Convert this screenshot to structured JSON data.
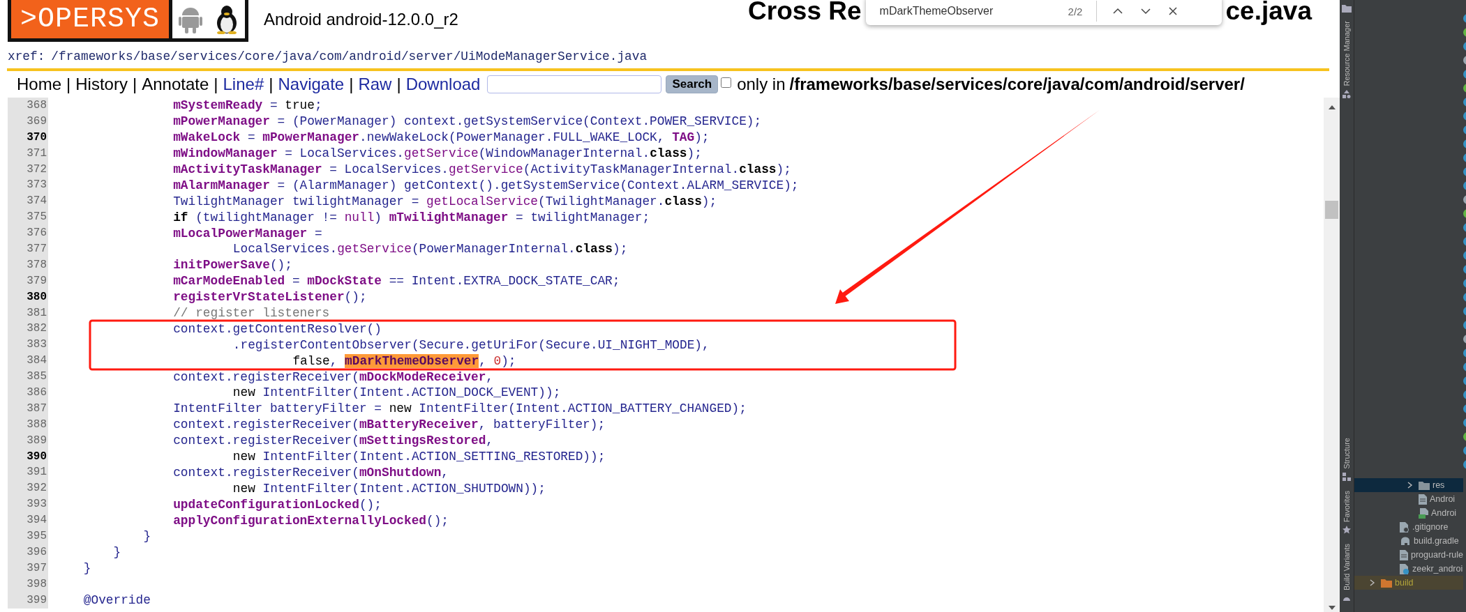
{
  "header": {
    "logo_text": ">OPERSYS",
    "project": "Android android-12.0.0_r2",
    "title_parts": [
      "Cross Re",
      "ce.java"
    ]
  },
  "find_bar": {
    "value": "mDarkThemeObserver",
    "count": "2/2"
  },
  "xref": {
    "label": "xref:",
    "segments": [
      "/frameworks",
      "/base",
      "/services",
      "/core",
      "/java",
      "/com",
      "/android",
      "/server",
      "/UiModeManagerService.java"
    ]
  },
  "nav": [
    {
      "label": "Home",
      "kind": "plain"
    },
    {
      "label": "|",
      "kind": "sep"
    },
    {
      "label": "History",
      "kind": "plain"
    },
    {
      "label": "|",
      "kind": "sep"
    },
    {
      "label": "Annotate",
      "kind": "plain"
    },
    {
      "label": "|",
      "kind": "sep"
    },
    {
      "label": "Line#",
      "kind": "link"
    },
    {
      "label": "|",
      "kind": "sep"
    },
    {
      "label": "Navigate",
      "kind": "link"
    },
    {
      "label": "|",
      "kind": "sep"
    },
    {
      "label": "Raw",
      "kind": "link"
    },
    {
      "label": "|",
      "kind": "sep"
    },
    {
      "label": "Download",
      "kind": "link"
    }
  ],
  "search": {
    "button": "Search",
    "only_in_checked": false,
    "only_in_label": "only in",
    "path": "/frameworks/base/services/core/java/com/android/server/"
  },
  "code": {
    "lines": [
      {
        "num": "368",
        "bold": false,
        "kind": "stmt",
        "tokens": [
          {
            "kind": "f",
            "text": "mSystemReady"
          },
          {
            "kind": "p",
            "text": " = "
          },
          {
            "kind": "w",
            "text": "true"
          },
          {
            "kind": "p",
            "text": ";"
          }
        ]
      },
      {
        "num": "369",
        "bold": false,
        "kind": "stmt",
        "tokens": [
          {
            "kind": "f",
            "text": "mPowerManager"
          },
          {
            "kind": "p",
            "text": " = (PowerManager) context.getSystemService(Context.POWER_SERVICE);"
          }
        ]
      },
      {
        "num": "370",
        "bold": true,
        "kind": "stmt",
        "tokens": [
          {
            "kind": "f",
            "text": "mWakeLock"
          },
          {
            "kind": "p",
            "text": " = "
          },
          {
            "kind": "f",
            "text": "mPowerManager"
          },
          {
            "kind": "p",
            "text": ".newWakeLock(PowerManager.FULL_WAKE_LOCK, "
          },
          {
            "kind": "f",
            "text": "TAG"
          },
          {
            "kind": "p",
            "text": ");"
          }
        ]
      },
      {
        "num": "371",
        "bold": false,
        "kind": "stmt",
        "tokens": [
          {
            "kind": "f",
            "text": "mWindowManager"
          },
          {
            "kind": "p",
            "text": " = LocalServices."
          },
          {
            "kind": "m",
            "text": "getService"
          },
          {
            "kind": "p",
            "text": "(WindowManagerInternal."
          },
          {
            "kind": "k",
            "text": "class"
          },
          {
            "kind": "p",
            "text": ");"
          }
        ]
      },
      {
        "num": "372",
        "bold": false,
        "kind": "stmt",
        "tokens": [
          {
            "kind": "f",
            "text": "mActivityTaskManager"
          },
          {
            "kind": "p",
            "text": " = LocalServices."
          },
          {
            "kind": "m",
            "text": "getService"
          },
          {
            "kind": "p",
            "text": "(ActivityTaskManagerInternal."
          },
          {
            "kind": "k",
            "text": "class"
          },
          {
            "kind": "p",
            "text": ");"
          }
        ]
      },
      {
        "num": "373",
        "bold": false,
        "kind": "stmt",
        "tokens": [
          {
            "kind": "f",
            "text": "mAlarmManager"
          },
          {
            "kind": "p",
            "text": " = (AlarmManager) getContext().getSystemService(Context.ALARM_SERVICE);"
          }
        ]
      },
      {
        "num": "374",
        "bold": false,
        "kind": "stmt",
        "tokens": [
          {
            "kind": "p",
            "text": "TwilightManager twilightManager = "
          },
          {
            "kind": "m",
            "text": "getLocalService"
          },
          {
            "kind": "p",
            "text": "(TwilightManager."
          },
          {
            "kind": "k",
            "text": "class"
          },
          {
            "kind": "p",
            "text": ");"
          }
        ]
      },
      {
        "num": "375",
        "bold": false,
        "kind": "stmt",
        "tokens": [
          {
            "kind": "k",
            "text": "if"
          },
          {
            "kind": "p",
            "text": " (twilightManager != "
          },
          {
            "kind": "m",
            "text": "null"
          },
          {
            "kind": "p",
            "text": ") "
          },
          {
            "kind": "f",
            "text": "mTwilightManager"
          },
          {
            "kind": "p",
            "text": " = twilightManager;"
          }
        ]
      },
      {
        "num": "376",
        "bold": false,
        "kind": "stmt",
        "tokens": [
          {
            "kind": "f",
            "text": "mLocalPowerManager"
          },
          {
            "kind": "p",
            "text": " ="
          }
        ]
      },
      {
        "num": "377",
        "bold": false,
        "kind": "wrap",
        "tokens": [
          {
            "kind": "p",
            "text": "LocalServices."
          },
          {
            "kind": "m",
            "text": "getService"
          },
          {
            "kind": "p",
            "text": "(PowerManagerInternal."
          },
          {
            "kind": "k",
            "text": "class"
          },
          {
            "kind": "p",
            "text": ");"
          }
        ]
      },
      {
        "num": "378",
        "bold": false,
        "kind": "stmt",
        "tokens": [
          {
            "kind": "f",
            "text": "initPowerSave"
          },
          {
            "kind": "p",
            "text": "();"
          }
        ]
      },
      {
        "num": "379",
        "bold": false,
        "kind": "stmt",
        "tokens": [
          {
            "kind": "f",
            "text": "mCarModeEnabled"
          },
          {
            "kind": "p",
            "text": " = "
          },
          {
            "kind": "f",
            "text": "mDockState"
          },
          {
            "kind": "p",
            "text": " == Intent.EXTRA_DOCK_STATE_CAR;"
          }
        ]
      },
      {
        "num": "380",
        "bold": true,
        "kind": "stmt",
        "tokens": [
          {
            "kind": "f",
            "text": "registerVrStateListener"
          },
          {
            "kind": "p",
            "text": "();"
          }
        ]
      },
      {
        "num": "381",
        "bold": false,
        "kind": "stmt",
        "tokens": [
          {
            "kind": "c",
            "text": "// register listeners"
          }
        ]
      },
      {
        "num": "382",
        "bold": false,
        "kind": "stmt",
        "tokens": [
          {
            "kind": "p",
            "text": "context.getContentResolver()"
          }
        ]
      },
      {
        "num": "383",
        "bold": false,
        "kind": "wrap",
        "tokens": [
          {
            "kind": "p",
            "text": ".registerContentObserver(Secure.getUriFor(Secure.UI_NIGHT_MODE),"
          }
        ]
      },
      {
        "num": "384",
        "bold": false,
        "kind": "wrap2",
        "tokens": [
          {
            "kind": "w",
            "text": "false"
          },
          {
            "kind": "p",
            "text": ", "
          },
          {
            "kind": "h",
            "text": "mDarkThemeObserver"
          },
          {
            "kind": "p",
            "text": ", "
          },
          {
            "kind": "n",
            "text": "0"
          },
          {
            "kind": "p",
            "text": ");"
          }
        ]
      },
      {
        "num": "385",
        "bold": false,
        "kind": "stmt",
        "tokens": [
          {
            "kind": "p",
            "text": "context.registerReceiver("
          },
          {
            "kind": "f",
            "text": "mDockModeReceiver"
          },
          {
            "kind": "p",
            "text": ","
          }
        ]
      },
      {
        "num": "386",
        "bold": false,
        "kind": "wrap",
        "tokens": [
          {
            "kind": "w",
            "text": "new"
          },
          {
            "kind": "p",
            "text": " IntentFilter(Intent.ACTION_DOCK_EVENT));"
          }
        ]
      },
      {
        "num": "387",
        "bold": false,
        "kind": "stmt",
        "tokens": [
          {
            "kind": "p",
            "text": "IntentFilter batteryFilter = "
          },
          {
            "kind": "w",
            "text": "new"
          },
          {
            "kind": "p",
            "text": " IntentFilter(Intent.ACTION_BATTERY_CHANGED);"
          }
        ]
      },
      {
        "num": "388",
        "bold": false,
        "kind": "stmt",
        "tokens": [
          {
            "kind": "p",
            "text": "context.registerReceiver("
          },
          {
            "kind": "f",
            "text": "mBatteryReceiver"
          },
          {
            "kind": "p",
            "text": ", batteryFilter);"
          }
        ]
      },
      {
        "num": "389",
        "bold": false,
        "kind": "stmt",
        "tokens": [
          {
            "kind": "p",
            "text": "context.registerReceiver("
          },
          {
            "kind": "f",
            "text": "mSettingsRestored"
          },
          {
            "kind": "p",
            "text": ","
          }
        ]
      },
      {
        "num": "390",
        "bold": true,
        "kind": "wrap",
        "tokens": [
          {
            "kind": "w",
            "text": "new"
          },
          {
            "kind": "p",
            "text": " IntentFilter(Intent.ACTION_SETTING_RESTORED));"
          }
        ]
      },
      {
        "num": "391",
        "bold": false,
        "kind": "stmt",
        "tokens": [
          {
            "kind": "p",
            "text": "context.registerReceiver("
          },
          {
            "kind": "f",
            "text": "mOnShutdown"
          },
          {
            "kind": "p",
            "text": ","
          }
        ]
      },
      {
        "num": "392",
        "bold": false,
        "kind": "wrap",
        "tokens": [
          {
            "kind": "w",
            "text": "new"
          },
          {
            "kind": "p",
            "text": " IntentFilter(Intent.ACTION_SHUTDOWN));"
          }
        ]
      },
      {
        "num": "393",
        "bold": false,
        "kind": "stmt",
        "tokens": [
          {
            "kind": "f",
            "text": "updateConfigurationLocked"
          },
          {
            "kind": "p",
            "text": "();"
          }
        ]
      },
      {
        "num": "394",
        "bold": false,
        "kind": "stmt",
        "tokens": [
          {
            "kind": "f",
            "text": "applyConfigurationExternallyLocked"
          },
          {
            "kind": "p",
            "text": "();"
          }
        ]
      },
      {
        "num": "395",
        "bold": false,
        "kind": "block",
        "tokens": [
          {
            "kind": "p",
            "text": "}"
          }
        ]
      },
      {
        "num": "396",
        "bold": false,
        "kind": "method",
        "tokens": [
          {
            "kind": "p",
            "text": "}"
          }
        ]
      },
      {
        "num": "397",
        "bold": false,
        "kind": "member",
        "tokens": [
          {
            "kind": "p",
            "text": "}"
          }
        ]
      },
      {
        "num": "398",
        "bold": false
      },
      {
        "num": "399",
        "bold": false,
        "kind": "member",
        "tokens": [
          {
            "kind": "p",
            "text": "@Override"
          }
        ]
      }
    ]
  },
  "ide": {
    "tool_tabs": [
      {
        "label": "Resource Manager",
        "kind": "resources"
      },
      {
        "label": "Structure",
        "kind": "structure"
      },
      {
        "label": "Favorites",
        "kind": "favorites"
      },
      {
        "label": "Build Variants",
        "kind": "variants"
      }
    ],
    "tree": [
      {
        "children": [
          {
            "children": [
              {
                "label": "res",
                "kind": "folder",
                "selected": true,
                "excluded": false
              },
              {
                "label": "Androi",
                "kind": "file",
                "selected": false,
                "excluded": false
              },
              {
                "label": "Androi",
                "kind": "manifest",
                "selected": false,
                "excluded": false
              }
            ]
          },
          {
            "label": ".gitignore",
            "kind": "ignore",
            "selected": false,
            "excluded": false
          },
          {
            "label": "build.gradle",
            "kind": "gradle",
            "selected": false,
            "excluded": false
          },
          {
            "label": "proguard-rule",
            "kind": "file",
            "selected": false,
            "excluded": false
          },
          {
            "label": "zeekr_androi",
            "kind": "unknown",
            "selected": false,
            "excluded": false
          }
        ]
      },
      {
        "label": "build",
        "kind": "folder",
        "selected": false,
        "excluded": true
      }
    ],
    "file_marks": [
      {
        "color": "#3592c4"
      },
      {
        "color": "#62b543"
      },
      {
        "color": "#3592c4"
      },
      {
        "color": "#9aa7b0"
      },
      {
        "color": "#3592c4"
      },
      {
        "color": "#62b543"
      },
      {
        "color": "#3592c4"
      },
      {
        "color": "#3592c4"
      },
      {
        "color": "#3592c4"
      },
      {
        "color": "#3592c4"
      },
      {
        "color": "#3592c4"
      },
      {
        "color": "#3592c4"
      },
      {
        "color": "#3592c4"
      },
      {
        "color": "#9aa7b0"
      },
      {
        "color": "#62b543"
      },
      {
        "color": "#3592c4"
      },
      {
        "color": "#3592c4"
      },
      {
        "color": "#3592c4"
      },
      {
        "color": "#3592c4"
      },
      {
        "color": "#3592c4"
      },
      {
        "color": "#3592c4"
      },
      {
        "color": "#3592c4"
      },
      {
        "color": "#3592c4"
      },
      {
        "color": "#9aa7b0"
      },
      {
        "color": "#3592c4"
      },
      {
        "color": "#3592c4"
      },
      {
        "color": "#3592c4"
      },
      {
        "color": "#3592c4"
      },
      {
        "color": "#3592c4"
      },
      {
        "color": "#3592c4"
      },
      {
        "color": "#62b543"
      },
      {
        "color": "#3592c4"
      },
      {
        "color": "#3592c4"
      }
    ]
  }
}
